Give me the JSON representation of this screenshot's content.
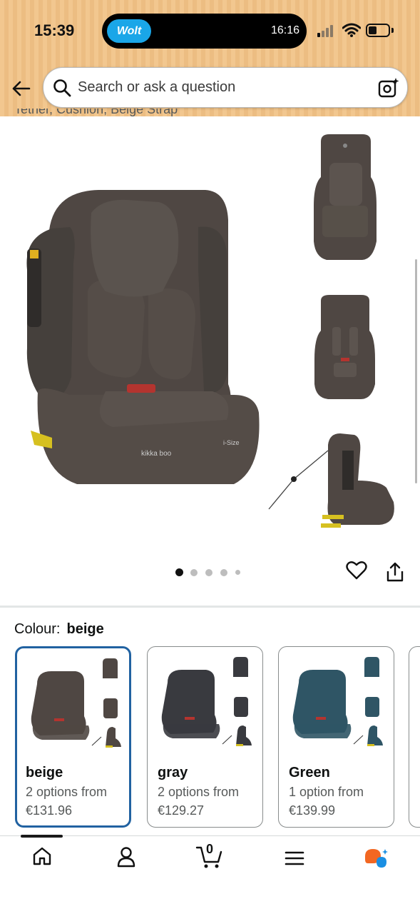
{
  "status_bar": {
    "time": "15:39",
    "island_app": "Wolt",
    "island_time": "16:16"
  },
  "search": {
    "placeholder": "Search or ask a question"
  },
  "product": {
    "cut_title": "Tether, Cushion, Beige Strap",
    "gallery_dots": 5,
    "gallery_active_dot": 0,
    "colour_label": "Colour:",
    "colour_value": "beige",
    "seat_color": "#4f4743"
  },
  "variants": [
    {
      "name": "beige",
      "options": "2 options from",
      "price": "€131.96",
      "selected": true,
      "color": "#4f4743"
    },
    {
      "name": "gray",
      "options": "2 options from",
      "price": "€129.27",
      "selected": false,
      "color": "#393a3f"
    },
    {
      "name": "Green",
      "options": "1 option from",
      "price": "€139.99",
      "selected": false,
      "color": "#2f5565"
    }
  ],
  "nav": {
    "items": [
      "home-icon",
      "account-icon",
      "cart-icon",
      "menu-icon",
      "ai-assistant-icon"
    ],
    "cart_count": "0"
  },
  "colors": {
    "header_bg": "#f2c78f",
    "selected_border": "#2162a1",
    "rufus_orange": "#f26722",
    "rufus_blue": "#1a8fe3"
  }
}
